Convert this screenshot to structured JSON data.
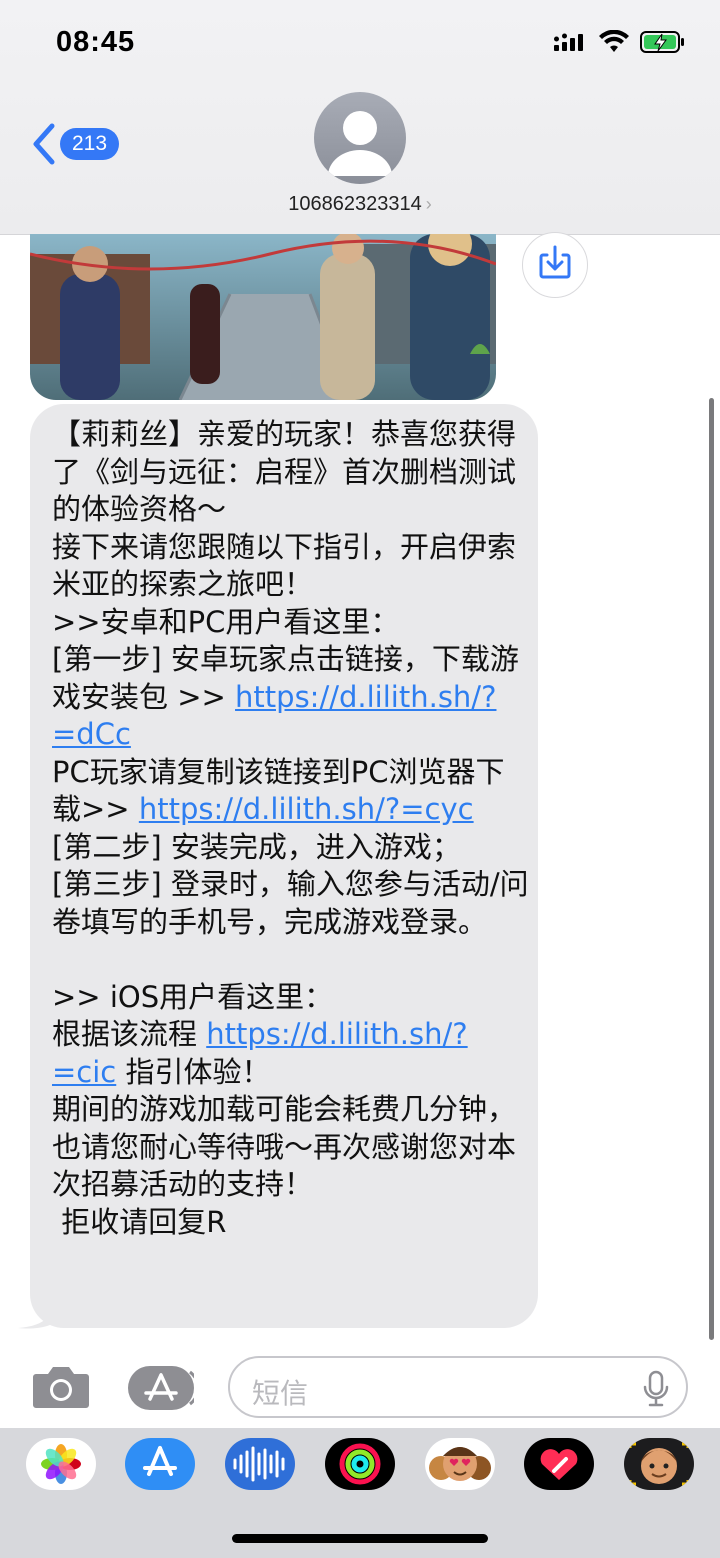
{
  "status": {
    "time": "08:45"
  },
  "header": {
    "back_count": "213",
    "contact": "106862323314"
  },
  "message": {
    "text_parts": [
      "【莉莉丝】亲爱的玩家！恭喜您获得了《剑与远征：启程》首次删档测试的体验资格～\n接下来请您跟随以下指引，开启伊索米亚的探索之旅吧！\n>>安卓和PC用户看这里：\n[第一步] 安卓玩家点击链接，下载游戏安装包 >> ",
      "https://d.lilith.sh/?=dCc",
      "\nPC玩家请复制该链接到PC浏览器下载>> ",
      "https://d.lilith.sh/?=cyc",
      "\n[第二步] 安装完成，进入游戏；\n[第三步] 登录时，输入您参与活动/问卷填写的手机号，完成游戏登录。\n\n>> iOS用户看这里：\n根据该流程 ",
      "https://d.lilith.sh/?=cic",
      " 指引体验！\n期间的游戏加载可能会耗费几分钟，也请您耐心等待哦～再次感谢您对本次招募活动的支持！\n 拒收请回复R"
    ]
  },
  "composer": {
    "placeholder": "短信"
  },
  "colors": {
    "accent": "#3478f6",
    "bubble": "#e9e9eb",
    "link": "#2e7ef0"
  },
  "apps": [
    "photos-icon",
    "app-store-icon",
    "audio-icon",
    "activity-icon",
    "memoji-stickers-icon",
    "heart-digital-touch-icon",
    "memoji-icon"
  ]
}
